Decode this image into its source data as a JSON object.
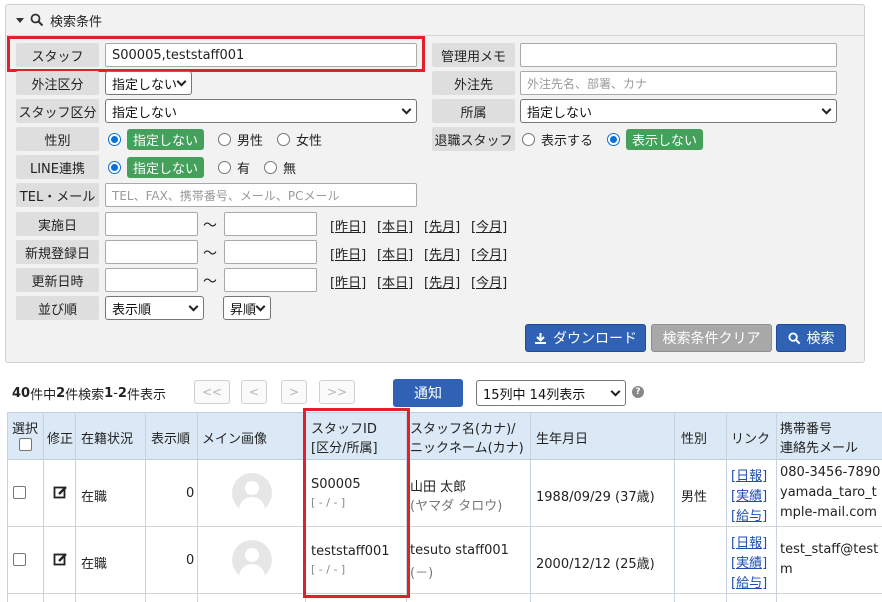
{
  "panel": {
    "title": "検索条件",
    "staff": {
      "label": "スタッフ",
      "value": "S00005,teststaff001"
    },
    "memo": {
      "label": "管理用メモ",
      "value": ""
    },
    "outsource_type": {
      "label": "外注区分",
      "value": "指定しない"
    },
    "outsource_dest": {
      "label": "外注先",
      "placeholder": "外注先名、部署、カナ"
    },
    "staff_type": {
      "label": "スタッフ区分",
      "value": "指定しない"
    },
    "affiliation": {
      "label": "所属",
      "value": "指定しない"
    },
    "gender": {
      "label": "性別",
      "options": [
        "指定しない",
        "男性",
        "女性"
      ],
      "selected": "指定しない"
    },
    "retired": {
      "label": "退職スタッフ",
      "options": [
        "表示する",
        "表示しない"
      ],
      "selected": "表示しない"
    },
    "line": {
      "label": "LINE連携",
      "options": [
        "指定しない",
        "有",
        "無"
      ],
      "selected": "指定しない"
    },
    "tel": {
      "label": "TEL・メール",
      "placeholder": "TEL、FAX、携帯番号、メール、PCメール"
    },
    "dates": [
      {
        "label": "実施日"
      },
      {
        "label": "新規登録日"
      },
      {
        "label": "更新日時"
      }
    ],
    "tilde": "～",
    "date_links": [
      "[昨日]",
      "[本日]",
      "[先月]",
      "[今月]"
    ],
    "sort": {
      "label": "並び順",
      "value": "表示順",
      "order": "昇順"
    },
    "buttons": {
      "download": "ダウンロード",
      "clear": "検索条件クリア",
      "search": "検索"
    }
  },
  "toolbar": {
    "total_num": "40",
    "total_suffix": "件中 ",
    "found_num": "2",
    "found_suffix": "件検索 ",
    "range_start": "1",
    "range_sep": "- ",
    "range_end": "2",
    "range_suffix": "件表示",
    "pager": [
      "<<",
      "<",
      ">",
      ">>"
    ],
    "notify": "通知",
    "columns_select": "15列中 14列表示",
    "help": "?"
  },
  "table": {
    "headers": {
      "select": "選択",
      "edit": "修正",
      "status": "在籍状況",
      "order": "表示順",
      "image": "メイン画像",
      "staff_id_1": "スタッフID",
      "staff_id_2": "[区分/所属]",
      "name_1": "スタッフ名(カナ)/",
      "name_2": "ニックネーム(カナ)",
      "birth": "生年月日",
      "gender": "性別",
      "link": "リンク",
      "contact_1": "携帯番号",
      "contact_2": "連絡先メール"
    },
    "rows": [
      {
        "status": "在職",
        "order": "0",
        "staff_id": "S00005",
        "staff_sub": "[ - / - ]",
        "name": "山田 太郎",
        "kana": "(ヤマダ タロウ)",
        "birth": "1988/09/29 (37歳)",
        "gender": "男性",
        "links": [
          "[日報]",
          "[実績]",
          "[給与]"
        ],
        "contact_1": "080-3456-7890",
        "contact_2": "yamada_taro_t",
        "contact_3": "mple-mail.com"
      },
      {
        "status": "在職",
        "order": "0",
        "staff_id": "teststaff001",
        "staff_sub": "[ - / - ]",
        "name": "tesuto staff001",
        "kana": "(－)",
        "birth": "2000/12/12 (25歳)",
        "gender": "",
        "links": [
          "[日報]",
          "[実績]",
          "[給与]"
        ],
        "contact_1": "test_staff@test",
        "contact_2": "m",
        "contact_3": ""
      }
    ]
  },
  "colors": {
    "accent": "#2f62b5",
    "highlight": "#e0202a",
    "pill": "#44a05a",
    "header_bg": "#dbe9f6"
  }
}
